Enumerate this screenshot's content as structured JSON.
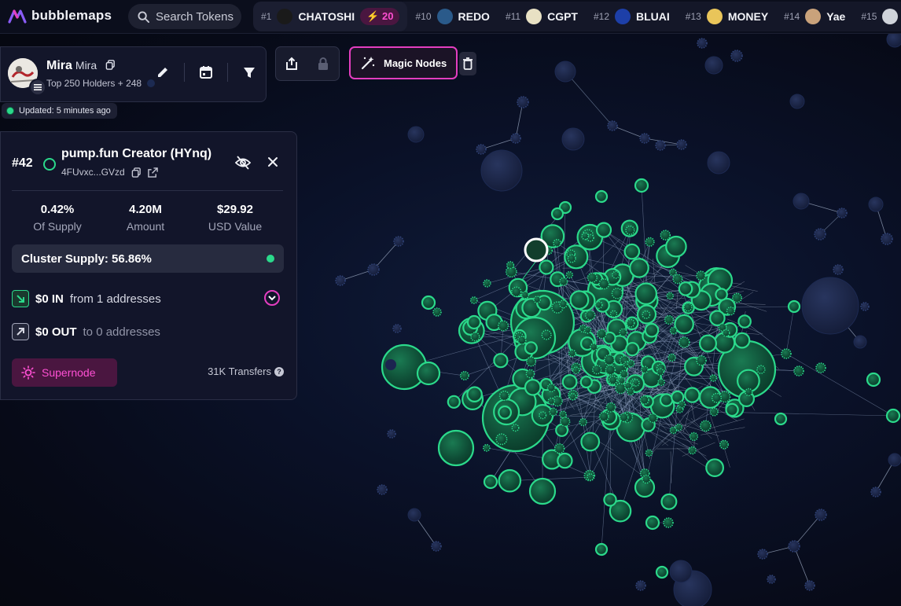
{
  "header": {
    "brand": "bubblemaps",
    "search_placeholder": "Search Tokens",
    "ticker": [
      {
        "rank": "#1",
        "name": "CHATOSHI",
        "badge": "20",
        "logo_color": "#1a1a1a",
        "active": true
      },
      {
        "rank": "#10",
        "name": "REDO",
        "logo_color": "#2a5a8a"
      },
      {
        "rank": "#11",
        "name": "CGPT",
        "logo_color": "#e8e1c4"
      },
      {
        "rank": "#12",
        "name": "BLUAI",
        "logo_color": "#1d3fa8"
      },
      {
        "rank": "#13",
        "name": "MONEY",
        "logo_color": "#e9c55a"
      },
      {
        "rank": "#14",
        "name": "Yae",
        "logo_color": "#c9a27b"
      },
      {
        "rank": "#15",
        "name": "",
        "logo_color": "#cfd3da"
      }
    ]
  },
  "token": {
    "name": "Mira",
    "symbol": "Mira",
    "subtitle": "Top 250 Holders + 248",
    "updated": "Updated: 5 minutes ago"
  },
  "toolbar": {
    "magic_label": "Magic Nodes"
  },
  "panel": {
    "rank": "#42",
    "title": "pump.fun Creator (HYnq)",
    "address": "4FUvxc...GVzd",
    "stats": [
      {
        "value": "0.42%",
        "label": "Of Supply"
      },
      {
        "value": "4.20M",
        "label": "Amount"
      },
      {
        "value": "$29.92",
        "label": "USD Value"
      }
    ],
    "cluster_supply": "Cluster Supply: 56.86%",
    "in_amount": "$0 IN",
    "in_sub": "from 1 addresses",
    "out_amount": "$0 OUT",
    "out_sub": "to 0 addresses",
    "supernode_label": "Supernode",
    "transfers": "31K Transfers"
  },
  "colors": {
    "accent_pink": "#e43ec0",
    "node_green": "#2bd98b",
    "node_dark": "#1c2a52"
  }
}
